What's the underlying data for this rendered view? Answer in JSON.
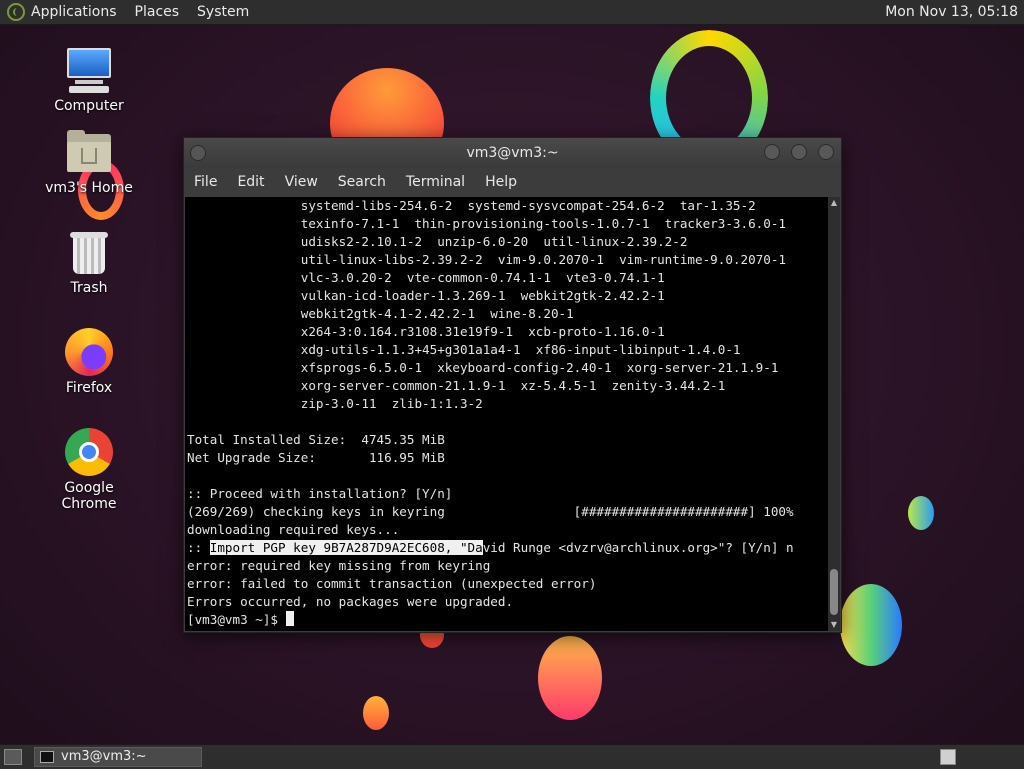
{
  "top_panel": {
    "menus": [
      "Applications",
      "Places",
      "System"
    ],
    "clock": "Mon Nov 13, 05:18"
  },
  "desktop": {
    "icons": [
      {
        "label": "Computer",
        "icon": "computer-icon"
      },
      {
        "label": "vm3's Home",
        "icon": "home-folder-icon"
      },
      {
        "label": "Trash",
        "icon": "trash-icon"
      },
      {
        "label": "Firefox",
        "icon": "firefox-icon"
      },
      {
        "label": "Google Chrome",
        "icon": "chrome-icon"
      }
    ]
  },
  "terminal": {
    "title": "vm3@vm3:~",
    "menu": [
      "File",
      "Edit",
      "View",
      "Search",
      "Terminal",
      "Help"
    ],
    "lines": [
      "               systemd-libs-254.6-2  systemd-sysvcompat-254.6-2  tar-1.35-2",
      "               texinfo-7.1-1  thin-provisioning-tools-1.0.7-1  tracker3-3.6.0-1",
      "               udisks2-2.10.1-2  unzip-6.0-20  util-linux-2.39.2-2",
      "               util-linux-libs-2.39.2-2  vim-9.0.2070-1  vim-runtime-9.0.2070-1",
      "               vlc-3.0.20-2  vte-common-0.74.1-1  vte3-0.74.1-1",
      "               vulkan-icd-loader-1.3.269-1  webkit2gtk-2.42.2-1",
      "               webkit2gtk-4.1-2.42.2-1  wine-8.20-1",
      "               x264-3:0.164.r3108.31e19f9-1  xcb-proto-1.16.0-1",
      "               xdg-utils-1.1.3+45+g301a1a4-1  xf86-input-libinput-1.4.0-1",
      "               xfsprogs-6.5.0-1  xkeyboard-config-2.40-1  xorg-server-21.1.9-1",
      "               xorg-server-common-21.1.9-1  xz-5.4.5-1  zenity-3.44.2-1",
      "               zip-3.0-11  zlib-1:1.3-2",
      "",
      "Total Installed Size:  4745.35 MiB",
      "Net Upgrade Size:       116.95 MiB",
      "",
      ":: Proceed with installation? [Y/n]",
      "(269/269) checking keys in keyring                 [######################] 100%",
      "downloading required keys..."
    ],
    "pgp_prefix": ":: ",
    "pgp_selected": "Import PGP key 9B7A287D9A2EC608, \"Da",
    "pgp_rest": "vid Runge <dvzrv@archlinux.org>\"? [Y/n] n",
    "lines_after": [
      "error: required key missing from keyring",
      "error: failed to commit transaction (unexpected error)",
      "Errors occurred, no packages were upgraded."
    ],
    "prompt": "[vm3@vm3 ~]$ "
  },
  "taskbar": {
    "window_label": "vm3@vm3:~"
  }
}
